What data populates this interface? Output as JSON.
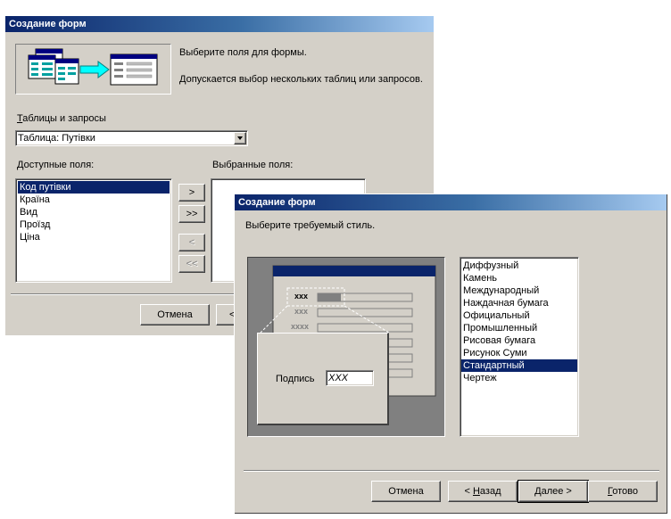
{
  "dialog1": {
    "title": "Создание форм",
    "instruction1": "Выберите поля для формы.",
    "instruction2": "Допускается выбор нескольких таблиц или запросов.",
    "tables_label_prefix": "",
    "tables_label_accel": "Т",
    "tables_label_rest": "аблицы и запросы",
    "table_select_value": "Таблица: Путівки",
    "available_label_accel": "Д",
    "available_label_rest": "оступные поля:",
    "selected_label": "Выбранные поля:",
    "available_fields": [
      "Код путівки",
      "Країна",
      "Вид",
      "Проїзд",
      "Ціна"
    ],
    "buttons": {
      "add_one": ">",
      "add_all": ">>",
      "remove_one": "<",
      "remove_all": "<<",
      "cancel": "Отмена",
      "back_partial": "<"
    }
  },
  "dialog2": {
    "title": "Создание форм",
    "instruction": "Выберите требуемый стиль.",
    "preview_label": "Подпись",
    "preview_field": "XXX",
    "preview_row_labels": [
      "xxx",
      "xxx",
      "xxxx"
    ],
    "styles": [
      "Диффузный",
      "Камень",
      "Международный",
      "Наждачная бумага",
      "Официальный",
      "Промышленный",
      "Рисовая бумага",
      "Рисунок Суми",
      "Стандартный",
      "Чертеж"
    ],
    "selected_style": "Стандартный",
    "buttons": {
      "cancel": "Отмена",
      "back_prefix": "< ",
      "back_accel": "Н",
      "back_rest": "азад",
      "next_accel": "Д",
      "next_rest": "алее >",
      "finish_accel": "Г",
      "finish_rest": "отово"
    }
  },
  "colors": {
    "titlebar_start": "#0a246a",
    "titlebar_end": "#a6caf0",
    "selection": "#0a246a",
    "window_bg": "#d4d0c8"
  }
}
